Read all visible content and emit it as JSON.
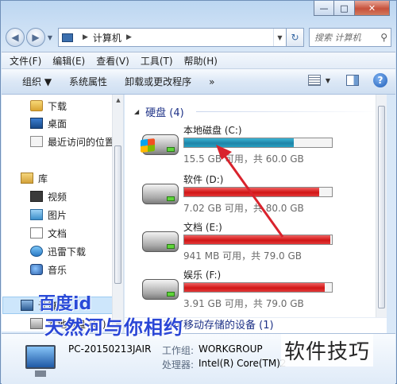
{
  "window": {
    "caption": {
      "minimize": "—",
      "maximize": "□",
      "close": "✕"
    }
  },
  "address": {
    "path": "计算机",
    "search_placeholder": "搜索 计算机"
  },
  "menu": [
    "文件(F)",
    "编辑(E)",
    "查看(V)",
    "工具(T)",
    "帮助(H)"
  ],
  "commands": [
    "组织 ▼",
    "系统属性",
    "卸载或更改程序",
    "»"
  ],
  "nav": {
    "items": [
      {
        "label": "下载",
        "icon": "download-folder-icon"
      },
      {
        "label": "桌面",
        "icon": "desktop-icon"
      },
      {
        "label": "最近访问的位置",
        "icon": "recent-places-icon"
      },
      {
        "label": "库",
        "icon": "library-icon"
      },
      {
        "label": "视频",
        "icon": "video-library-icon"
      },
      {
        "label": "图片",
        "icon": "picture-library-icon"
      },
      {
        "label": "文档",
        "icon": "document-library-icon"
      },
      {
        "label": "迅雷下载",
        "icon": "thunder-download-icon"
      },
      {
        "label": "音乐",
        "icon": "music-library-icon"
      },
      {
        "label": "计算机",
        "icon": "computer-icon"
      },
      {
        "label": "本地磁盘 (C:)",
        "icon": "local-disk-icon"
      }
    ]
  },
  "content": {
    "section_title": "硬盘 (4)",
    "removable_title": "有可移动存储的设备 (1)",
    "drives": [
      {
        "name": "本地磁盘 (C:)",
        "space": "15.5 GB 可用，共 60.0 GB",
        "used_fraction": 0.7417,
        "bar_color": "#1f84a7",
        "system": true
      },
      {
        "name": "软件 (D:)",
        "space": "7.02 GB 可用，共 80.0 GB",
        "used_fraction": 0.9123,
        "bar_color": "#d11616",
        "system": false
      },
      {
        "name": "文档 (E:)",
        "space": "941 MB 可用，共 79.0 GB",
        "used_fraction": 0.9884,
        "bar_color": "#d11616",
        "system": false
      },
      {
        "name": "娱乐 (F:)",
        "space": "3.91 GB 可用，共 79.0 GB",
        "used_fraction": 0.9505,
        "bar_color": "#d11616",
        "system": false
      }
    ]
  },
  "details": {
    "computer_name": "PC-20150213JAIR",
    "workgroup_label": "工作组:",
    "workgroup_value": "WORKGROUP",
    "processor_label": "处理器:",
    "processor_value": "Intel(R) Core(TM)2"
  },
  "watermarks": {
    "baidu": "百度id",
    "slogan": "天然河与你相约",
    "tips": "软件技巧"
  },
  "colors": {
    "annotation_arrow": "#d9232d"
  }
}
